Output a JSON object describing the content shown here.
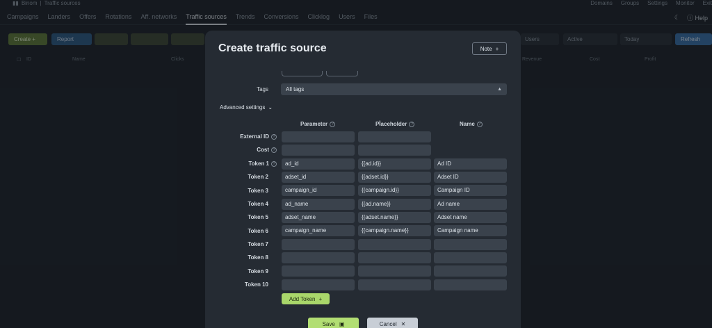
{
  "app": {
    "brand": "Binom",
    "breadcrumb": "Traffic sources",
    "top_links": [
      "Domains",
      "Groups",
      "Settings",
      "Monitor",
      "Exit"
    ],
    "nav_tabs": [
      "Campaigns",
      "Landers",
      "Offers",
      "Rotations",
      "Aff. networks",
      "Traffic sources",
      "Trends",
      "Conversions",
      "Clicklog",
      "Users",
      "Files"
    ],
    "active_tab": "Traffic sources",
    "help_label": "Help",
    "toolbar": {
      "create_label": "Create",
      "report_label": "Report",
      "users_filter": "Users",
      "status_filter": "Active",
      "date_filter": "Today",
      "refresh_label": "Refresh"
    },
    "table_headers": [
      "ID",
      "Name",
      "Clicks",
      "Revenue",
      "Cost",
      "Profit"
    ]
  },
  "modal": {
    "title": "Create traffic source",
    "note_label": "Note",
    "tags_label": "Tags",
    "tags_value": "All tags",
    "advanced_label": "Advanced settings",
    "columns": {
      "parameter": "Parameter",
      "placeholder": "Placeholder",
      "name": "Name"
    },
    "rows": [
      {
        "label": "External ID",
        "parameter": "",
        "placeholder": "",
        "name": ""
      },
      {
        "label": "Cost",
        "parameter": "",
        "placeholder": "",
        "name": ""
      },
      {
        "label": "Token 1",
        "parameter": "ad_id",
        "placeholder": "{{ad.id}}",
        "name": "Ad ID"
      },
      {
        "label": "Token 2",
        "parameter": "adset_id",
        "placeholder": "{{adset.id}}",
        "name": "Adset ID"
      },
      {
        "label": "Token 3",
        "parameter": "campaign_id",
        "placeholder": "{{campaign.id}}",
        "name": "Campaign ID"
      },
      {
        "label": "Token 4",
        "parameter": "ad_name",
        "placeholder": "{{ad.name}}",
        "name": "Ad name"
      },
      {
        "label": "Token 5",
        "parameter": "adset_name",
        "placeholder": "{{adset.name}}",
        "name": "Adset name"
      },
      {
        "label": "Token 6",
        "parameter": "campaign_name",
        "placeholder": "{{campaign.name}}",
        "name": "Campaign name"
      },
      {
        "label": "Token 7",
        "parameter": "",
        "placeholder": "",
        "name": ""
      },
      {
        "label": "Token 8",
        "parameter": "",
        "placeholder": "",
        "name": ""
      },
      {
        "label": "Token 9",
        "parameter": "",
        "placeholder": "",
        "name": ""
      },
      {
        "label": "Token 10",
        "parameter": "",
        "placeholder": "",
        "name": ""
      }
    ],
    "add_token_label": "Add Token",
    "save_label": "Save",
    "cancel_label": "Cancel"
  }
}
